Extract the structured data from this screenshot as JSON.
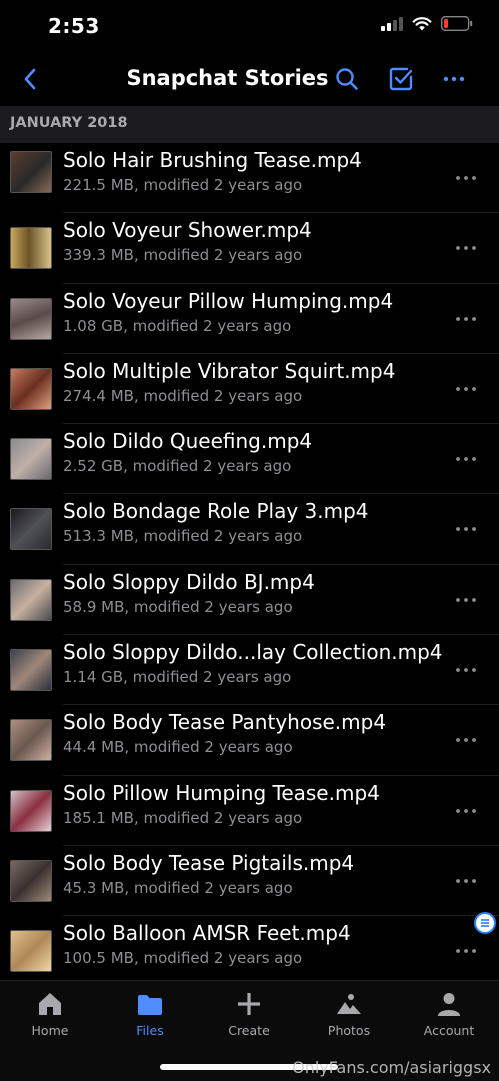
{
  "status": {
    "time": "2:53"
  },
  "nav": {
    "title": "Snapchat Stories"
  },
  "section": {
    "header": "JANUARY 2018"
  },
  "files": [
    {
      "name": "Solo Hair Brushing Tease.mp4",
      "meta": "221.5 MB, modified 2 years ago"
    },
    {
      "name": "Solo Voyeur Shower.mp4",
      "meta": "339.3 MB, modified 2 years ago"
    },
    {
      "name": "Solo Voyeur Pillow Humping.mp4",
      "meta": "1.08 GB, modified 2 years ago"
    },
    {
      "name": "Solo Multiple Vibrator Squirt.mp4",
      "meta": "274.4 MB, modified 2 years ago"
    },
    {
      "name": "Solo Dildo Queefing.mp4",
      "meta": "2.52 GB, modified 2 years ago"
    },
    {
      "name": "Solo Bondage Role Play 3.mp4",
      "meta": "513.3 MB, modified 2 years ago"
    },
    {
      "name": "Solo Sloppy Dildo BJ.mp4",
      "meta": "58.9 MB, modified 2 years ago"
    },
    {
      "name": "Solo Sloppy Dildo...lay Collection.mp4",
      "meta": "1.14 GB, modified 2 years ago"
    },
    {
      "name": "Solo Body Tease Pantyhose.mp4",
      "meta": "44.4 MB, modified 2 years ago"
    },
    {
      "name": "Solo Pillow Humping Tease.mp4",
      "meta": "185.1 MB, modified 2 years ago"
    },
    {
      "name": "Solo Body Tease Pigtails.mp4",
      "meta": "45.3 MB, modified 2 years ago"
    },
    {
      "name": "Solo Balloon AMSR Feet.mp4",
      "meta": "100.5 MB, modified 2 years ago"
    }
  ],
  "tabs": [
    {
      "label": "Home",
      "icon": "home-icon"
    },
    {
      "label": "Files",
      "icon": "folder-icon"
    },
    {
      "label": "Create",
      "icon": "plus-icon"
    },
    {
      "label": "Photos",
      "icon": "photos-icon"
    },
    {
      "label": "Account",
      "icon": "person-icon"
    }
  ],
  "watermark": "OnlyFans.com/asiariggsx",
  "colors": {
    "accent": "#4f8cff",
    "battery_low": "#ff3b30",
    "background": "#000000",
    "section_header_bg": "#1c1c1e",
    "secondary_text": "#8e8e93"
  }
}
